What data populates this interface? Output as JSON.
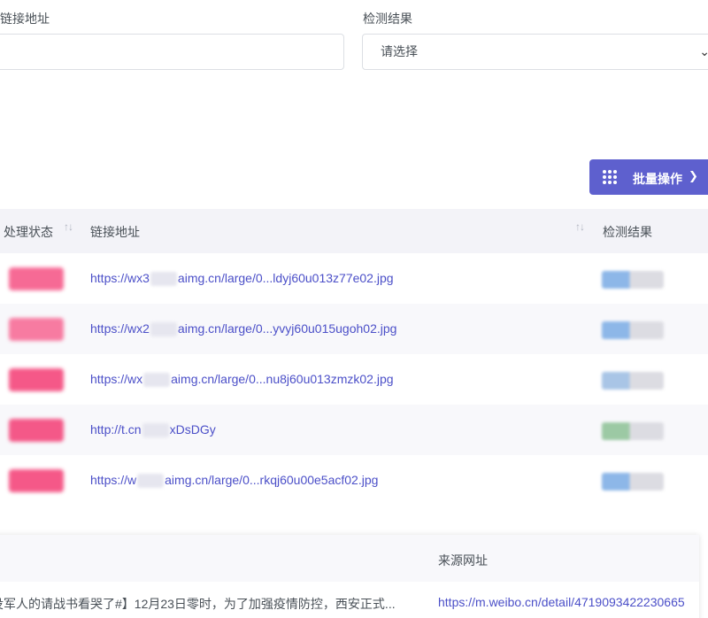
{
  "filters": {
    "link_label": "链接地址",
    "result_label": "检测结果",
    "result_select_value": "请选择"
  },
  "bulk_button": {
    "label": "批量操作"
  },
  "table": {
    "headers": [
      "处理状态",
      "链接地址",
      "检测结果"
    ],
    "rows": [
      {
        "prefix": "https://wx3",
        "suffix": "aimg.cn/large/0...ldyj60u013z77e02.jpg",
        "status_color": "#f65a8a",
        "result_color": "#8db7e8"
      },
      {
        "prefix": "https://wx2",
        "suffix": "aimg.cn/large/0...yvyj60u015ugoh02.jpg",
        "status_color": "#f76e98",
        "result_color": "#8db7e8"
      },
      {
        "prefix": "https://wx",
        "suffix": "aimg.cn/large/0...nu8j60u013zmzk02.jpg",
        "status_color": "#f4477c",
        "result_color": "#a9c5e6"
      },
      {
        "prefix": "http://t.cn",
        "suffix": "xDsDGy",
        "status_color": "#f4477c",
        "result_color": "#9cc9a4"
      },
      {
        "prefix": "https://w",
        "suffix": "aimg.cn/large/0...rkqj60u00e5acf02.jpg",
        "status_color": "#f4477c",
        "result_color": "#8db7e8"
      }
    ]
  },
  "source_card": {
    "header": "来源网址",
    "title": "役军人的请战书看哭了#】12月23日零时，为了加强疫情防控，西安正式...",
    "url": "https://m.weibo.cn/detail/4719093422230665"
  }
}
